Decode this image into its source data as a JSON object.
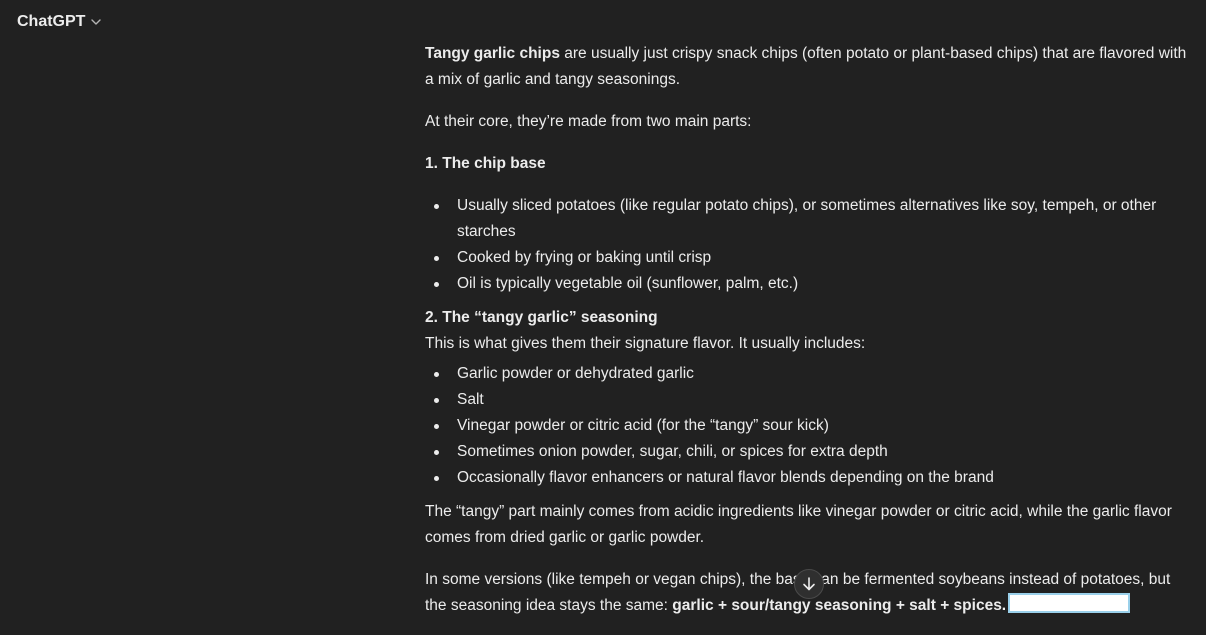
{
  "header": {
    "model_name": "ChatGPT"
  },
  "message": {
    "intro_bold": "Tangy garlic chips",
    "intro_rest": " are usually just crispy snack chips (often potato or plant-based chips) that are flavored with a mix of garlic and tangy seasonings.",
    "core_line": "At their core, they’re made from two main parts:",
    "section1_title": "1. The chip base",
    "section1_items": [
      "Usually sliced potatoes (like regular potato chips), or sometimes alternatives like soy, tempeh, or other starches",
      "Cooked by frying or baking until crisp",
      "Oil is typically vegetable oil (sunflower, palm, etc.)"
    ],
    "section2_title": "2. The “tangy garlic” seasoning",
    "section2_intro": "This is what gives them their signature flavor. It usually includes:",
    "section2_items": [
      "Garlic powder or dehydrated garlic",
      "Salt",
      "Vinegar powder or citric acid (for the “tangy” sour kick)",
      "Sometimes onion powder, sugar, chili, or spices for extra depth",
      "Occasionally flavor enhancers or natural flavor blends depending on the brand"
    ],
    "tangy_explanation": "The “tangy” part mainly comes from acidic ingredients like vinegar powder or citric acid, while the garlic flavor comes from dried garlic or garlic powder.",
    "versions_text": "In some versions (like tempeh or vegan chips), the base can be fermented soybeans instead of potatoes, but the seasoning idea stays the same: ",
    "versions_bold": "garlic + sour/tangy seasoning + salt + spices."
  },
  "icons": {
    "model_chevron": "chevron-down-icon",
    "scroll_down": "arrow-down-icon"
  },
  "colors": {
    "background": "#212121",
    "text": "#ececec",
    "highlight_border": "#9ad0ea"
  }
}
